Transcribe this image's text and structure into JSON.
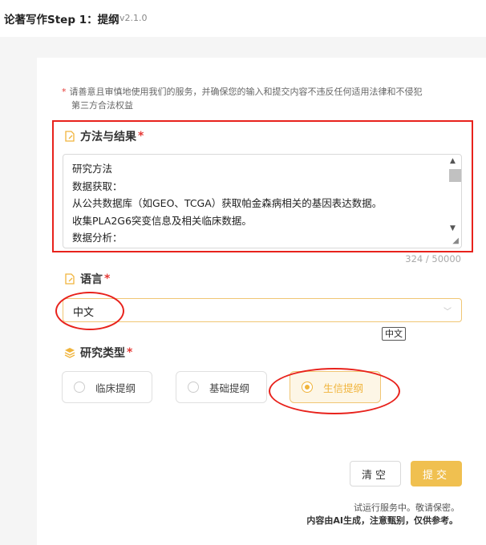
{
  "header": {
    "title": "论著写作Step 1：提纲",
    "version": "v2.1.0"
  },
  "notice": {
    "star": "*",
    "line1": "请善意且审慎地使用我们的服务，并确保您的输入和提交内容不违反任何适用法律和不侵犯",
    "line2": "第三方合法权益"
  },
  "methods": {
    "label": "方法与结果",
    "required": "*",
    "text": "研究方法\n数据获取：\n从公共数据库（如GEO、TCGA）获取帕金森病相关的基因表达数据。\n收集PLA2G6突变信息及相关临床数据。\n数据分析：",
    "counter": "324 / 50000"
  },
  "language": {
    "label": "语言",
    "required": "*",
    "value": "中文",
    "tooltip": "中文"
  },
  "research_type": {
    "label": "研究类型",
    "required": "*",
    "options": [
      "临床提纲",
      "基础提纲",
      "生信提纲"
    ],
    "selected": "生信提纲"
  },
  "buttons": {
    "clear": "清空",
    "submit": "提交"
  },
  "footer": {
    "line1": "试运行服务中。敬请保密。",
    "line2": "内容由AI生成，注意甄别，仅供参考。"
  },
  "colors": {
    "accent": "#f0c050",
    "highlight_red": "#e8221c"
  }
}
